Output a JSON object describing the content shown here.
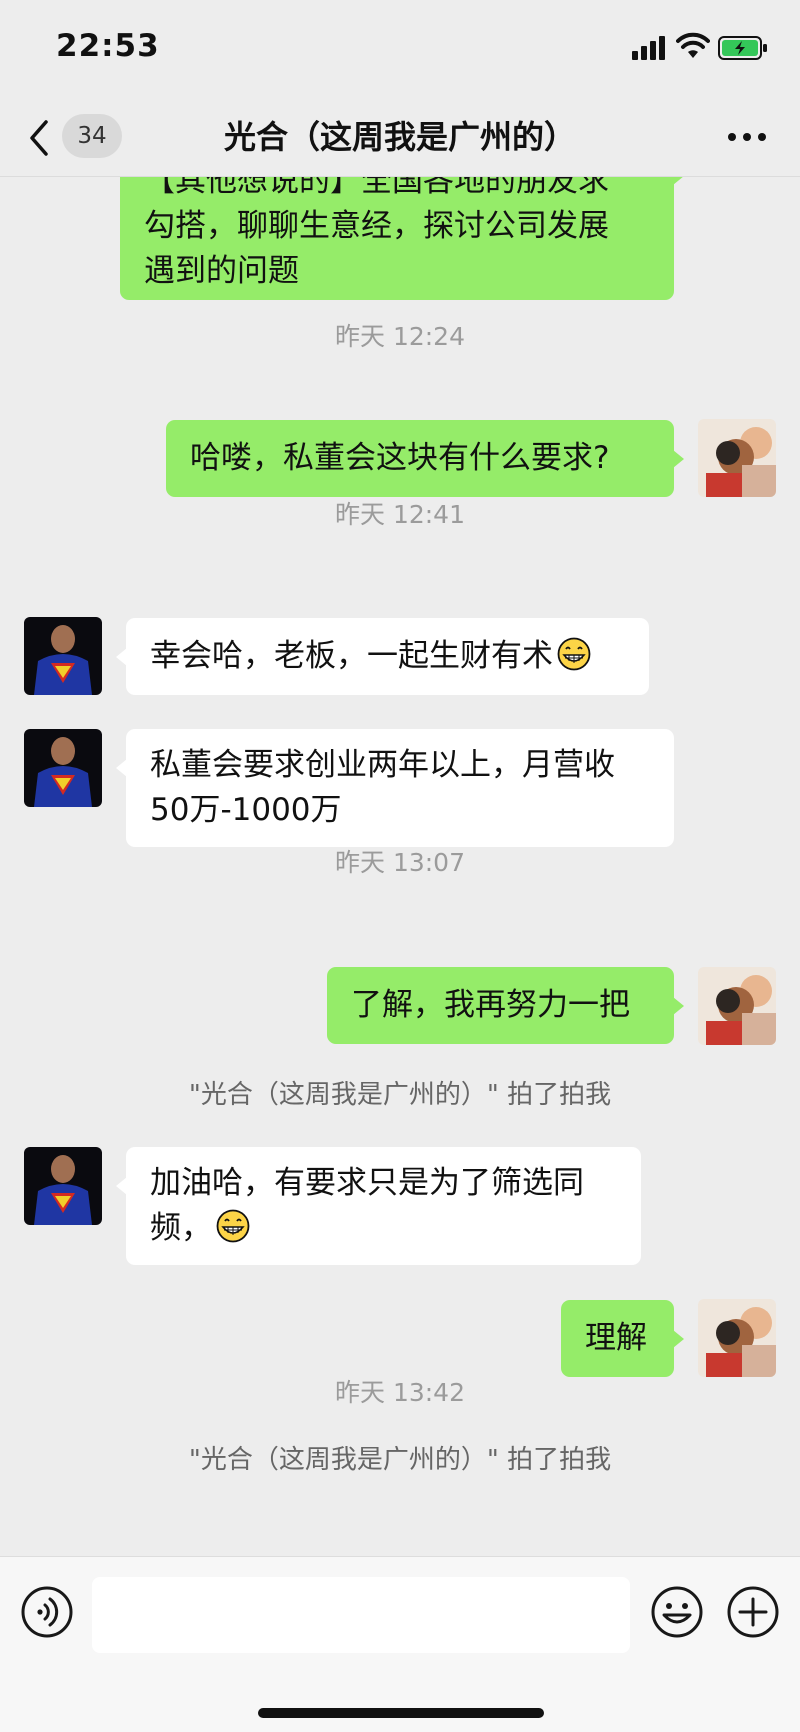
{
  "status_bar": {
    "time": "22:53",
    "icons": [
      "cellular-signal-icon",
      "wifi-icon",
      "battery-charging-icon"
    ]
  },
  "nav": {
    "back_icon": "chevron-left-icon",
    "unread_count": "34",
    "title": "光合（这周我是广州的）",
    "more_icon": "more-dots-icon"
  },
  "messages": [
    {
      "type": "outgoing",
      "text": "【其他想说的】全国各地的朋友求\n勾搭，聊聊生意经，探讨公司发展\n遇到的问题"
    },
    {
      "type": "timestamp",
      "text": "昨天 12:24"
    },
    {
      "type": "outgoing",
      "text": "哈喽，私董会这块有什么要求?"
    },
    {
      "type": "timestamp",
      "text": "昨天 12:41"
    },
    {
      "type": "incoming",
      "text": "幸会哈，老板，一起生财有术",
      "emoji": "grin-emoji"
    },
    {
      "type": "incoming",
      "text": "私董会要求创业两年以上，月营收\n50万-1000万"
    },
    {
      "type": "timestamp",
      "text": "昨天 13:07"
    },
    {
      "type": "outgoing",
      "text": "了解，我再努力一把"
    },
    {
      "type": "system",
      "text": "\"光合（这周我是广州的）\" 拍了拍我"
    },
    {
      "type": "incoming",
      "text": "加油哈，有要求只是为了筛选同\n频，",
      "emoji": "grin-emoji"
    },
    {
      "type": "outgoing",
      "text": "理解"
    },
    {
      "type": "timestamp",
      "text": "昨天 13:42"
    },
    {
      "type": "system",
      "text": "\"光合（这周我是广州的）\" 拍了拍我"
    }
  ],
  "input_bar": {
    "voice_icon": "voice-icon",
    "input_value": "",
    "emoji_icon": "emoji-icon",
    "plus_icon": "plus-icon"
  },
  "colors": {
    "background": "#ededed",
    "outgoing_bubble": "#95ec69",
    "incoming_bubble": "#ffffff",
    "timestamp_text": "#9b9b9b"
  }
}
